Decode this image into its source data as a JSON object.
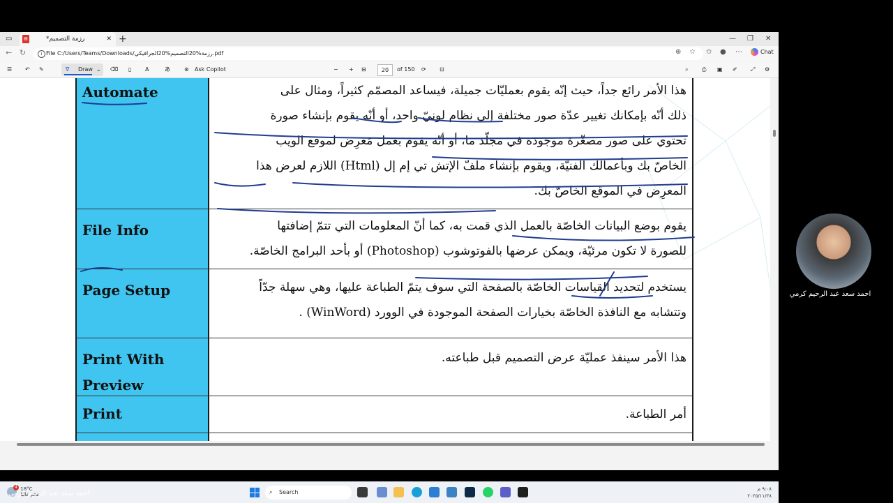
{
  "browser": {
    "tab_title": "*رزمة التصميم الجرافيكي.pdf",
    "file_label": "File",
    "url": "C:/Users/Teams/Downloads/رزمة%20التصميم%20الجرافيكي.pdf",
    "chat_label": "Chat"
  },
  "pdf_toolbar": {
    "draw_label": "Draw",
    "ask_copilot_label": "Ask Copilot",
    "page_current": "20",
    "page_total": "of 150"
  },
  "table": {
    "rows": [
      {
        "command": "Automate",
        "lines": [
          "هذا الأمر رائع جداً، حيث إنّه يقوم بعمليّات جميلة، فيساعد المصمّم كثيراً، ومثال على",
          "ذلك أنّه بإمكانك تغيير عدّة صور مختلفة إلى نظام لونيّ واحد، أو أنّه يقوم بإنشاء صورة",
          "تحتوي على صور مصغّرة موجودة في مجلّد ما، أو أنّه يقوم بعمل مَعرِض لموقع الويب",
          "الخاصّ بك وبأعمالك الفنيّة، ويقوم بإنشاء ملفّ الإتش تي إم إل (Html) اللازم لعرض هذا",
          "المعرِض في الموقع الخاصّ بك."
        ]
      },
      {
        "command": "File Info",
        "lines": [
          "يقوم بوضع البيانات الخاصّة بالعمل الذي قمت به، كما أنّ المعلومات التي تتمّ إضافتها",
          "للصورة لا تكون مرئيّة، ويمكن عرضها بالفوتوشوب (Photoshop) أو بأحد البرامج الخاصّة."
        ]
      },
      {
        "command": "Page Setup",
        "lines": [
          "يستخدم لتحديد القياسات الخاصّة بالصفحة التي سوف يتمّ الطباعة عليها، وهي سهلة جدّاً",
          "وتتشابه مع النافذة الخاصّة بخيارات الصفحة الموجودة في الوورد (WinWord) ."
        ]
      },
      {
        "command": "Print With Preview",
        "lines": [
          "هذا الأمر سينفذ عمليّة عرض التصميم قبل طباعته."
        ]
      },
      {
        "command": "Print",
        "lines": [
          "أمر الطباعة."
        ]
      }
    ]
  },
  "presenter": {
    "name": "احمد سعد عبد الرحيم كرمي",
    "bottom_name": "احمد سعد عبد الرحيم كرمي"
  },
  "taskbar": {
    "temperature": "18°C",
    "weather_text": "غائم غالبًا",
    "notification_count": "4",
    "search_label": "Search",
    "time": "٩:٠٨ م",
    "date": "٢٠٢٥/١١/٢٨"
  },
  "colors": {
    "command_cell": "#3fc5f0",
    "annotation_ink": "#1f3c8f",
    "draw_accent": "#1a57d6"
  }
}
